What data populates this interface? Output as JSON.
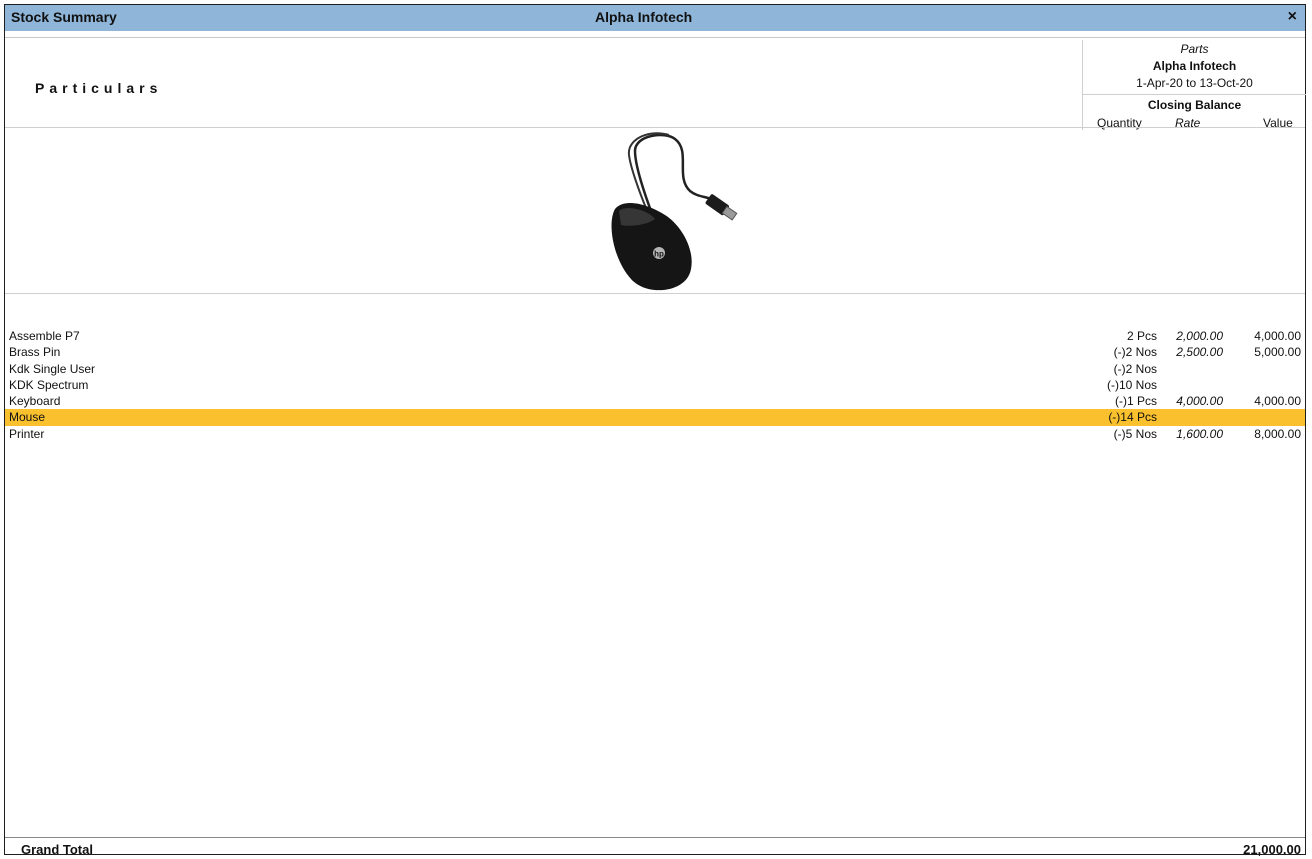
{
  "window": {
    "title": "Stock Summary",
    "company": "Alpha Infotech",
    "close_glyph": "×"
  },
  "header": {
    "particulars_label": "Particulars",
    "right": {
      "group": "Parts",
      "company": "Alpha Infotech",
      "period": "1-Apr-20 to 13-Oct-20",
      "closing_balance": "Closing Balance",
      "columns": [
        "Quantity",
        "Rate",
        "Value"
      ]
    }
  },
  "image": {
    "icon": "mouse-icon"
  },
  "rows": [
    {
      "name": "Assemble P7",
      "qty": "2 Pcs",
      "rate": "2,000.00",
      "value": "4,000.00"
    },
    {
      "name": "Brass Pin",
      "qty": "(-)2 Nos",
      "rate": "2,500.00",
      "value": "5,000.00"
    },
    {
      "name": "Kdk Single User",
      "qty": "(-)2 Nos",
      "rate": "",
      "value": ""
    },
    {
      "name": "KDK Spectrum",
      "qty": "(-)10 Nos",
      "rate": "",
      "value": ""
    },
    {
      "name": "Keyboard",
      "qty": "(-)1 Pcs",
      "rate": "4,000.00",
      "value": "4,000.00"
    },
    {
      "name": "Mouse",
      "qty": "(-)14 Pcs",
      "rate": "",
      "value": ""
    },
    {
      "name": "Printer",
      "qty": "(-)5 Nos",
      "rate": "1,600.00",
      "value": "8,000.00"
    }
  ],
  "selected_row": "Mouse",
  "colors": {
    "titlebar": "#8fb5d8",
    "selection": "#fbc02d"
  },
  "footer": {
    "grand_total_label": "Grand Total",
    "grand_total_value": "21,000.00"
  }
}
